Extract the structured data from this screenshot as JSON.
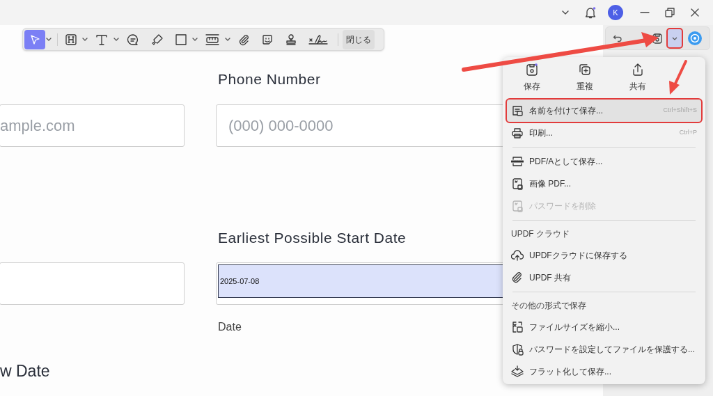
{
  "title_bar": {
    "avatar": "K"
  },
  "toolbar": {
    "tools": [
      {
        "kind": "select",
        "selected": true,
        "dropdown": true
      },
      {
        "kind": "heading",
        "selected": false,
        "dropdown": true
      },
      {
        "kind": "text",
        "selected": false,
        "dropdown": true
      },
      {
        "kind": "comment",
        "selected": false,
        "dropdown": false
      },
      {
        "kind": "highlighter",
        "selected": false,
        "dropdown": false
      },
      {
        "kind": "shape",
        "selected": false,
        "dropdown": true
      },
      {
        "kind": "measure",
        "selected": false,
        "dropdown": true
      },
      {
        "kind": "attach",
        "selected": false,
        "dropdown": false
      },
      {
        "kind": "sticker",
        "selected": false,
        "dropdown": false
      },
      {
        "kind": "stamp",
        "selected": false,
        "dropdown": false
      },
      {
        "kind": "signature",
        "selected": false,
        "dropdown": false
      }
    ],
    "close_button": "閉じる"
  },
  "document": {
    "phone_heading": "Phone Number",
    "email_placeholder": "ample.com",
    "phone_placeholder": "(000) 000-0000",
    "start_date_heading": "Earliest Possible Start Date",
    "start_date_value": "2025-07-08",
    "start_date_sublabel": "Date",
    "bottom_heading": "w Date"
  },
  "save_menu": {
    "actions": [
      {
        "kind": "save",
        "label": "保存",
        "badge": true
      },
      {
        "kind": "duplicate",
        "label": "重複",
        "badge": false
      },
      {
        "kind": "share",
        "label": "共有",
        "badge": false
      }
    ],
    "items": [
      {
        "kind": "item",
        "label": "名前を付けて保存...",
        "shortcut": "Ctrl+Shift+S",
        "highlighted": true,
        "disabled": false
      },
      {
        "kind": "item",
        "label": "印刷...",
        "shortcut": "Ctrl+P",
        "highlighted": false,
        "disabled": false
      },
      {
        "kind": "divider"
      },
      {
        "kind": "item",
        "label": "PDF/Aとして保存...",
        "highlighted": false,
        "disabled": false
      },
      {
        "kind": "item",
        "label": "画像 PDF...",
        "highlighted": false,
        "disabled": false
      },
      {
        "kind": "item",
        "label": "パスワードを削除",
        "highlighted": false,
        "disabled": true
      },
      {
        "kind": "divider"
      },
      {
        "kind": "header",
        "label": "UPDF クラウド"
      },
      {
        "kind": "item",
        "label": "UPDFクラウドに保存する",
        "highlighted": false,
        "disabled": false
      },
      {
        "kind": "item",
        "label": "UPDF 共有",
        "highlighted": false,
        "disabled": false
      },
      {
        "kind": "divider"
      },
      {
        "kind": "header",
        "label": "その他の形式で保存"
      },
      {
        "kind": "item",
        "label": "ファイルサイズを縮小...",
        "highlighted": false,
        "disabled": false
      },
      {
        "kind": "item",
        "label": "パスワードを設定してファイルを保護する...",
        "highlighted": false,
        "disabled": false
      },
      {
        "kind": "item",
        "label": "フラット化して保存...",
        "highlighted": false,
        "disabled": false
      }
    ]
  }
}
